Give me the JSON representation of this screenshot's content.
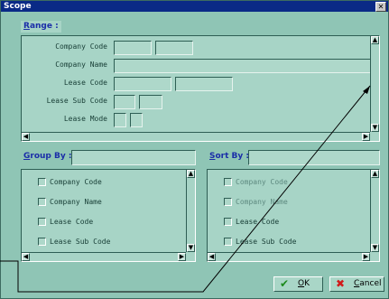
{
  "window": {
    "title": "Scope",
    "close_glyph": "✕"
  },
  "range": {
    "label": "Range :",
    "label_hotkey": "R",
    "label_rest": "ange :",
    "rows": [
      {
        "label": "Company Code"
      },
      {
        "label": "Company Name"
      },
      {
        "label": "Lease Code"
      },
      {
        "label": "Lease Sub Code"
      },
      {
        "label": "Lease Mode"
      }
    ]
  },
  "group_by": {
    "label_hotkey": "G",
    "label_rest": "roup By :",
    "options": [
      {
        "label": "Company Code"
      },
      {
        "label": "Company Name"
      },
      {
        "label": "Lease Code"
      },
      {
        "label": "Lease Sub Code"
      }
    ]
  },
  "sort_by": {
    "label_hotkey": "S",
    "label_rest": "ort By :",
    "options": [
      {
        "label": "Company Code",
        "disabled": true
      },
      {
        "label": "Company Name",
        "disabled": true
      },
      {
        "label": "Lease Code",
        "disabled": false
      },
      {
        "label": "Lease Sub Code",
        "disabled": false
      }
    ]
  },
  "buttons": {
    "ok_hotkey": "O",
    "ok_rest": "K",
    "cancel_hotkey": "C",
    "cancel_rest": "ancel",
    "ok_icon": "✔",
    "cancel_icon": "✖"
  },
  "colors": {
    "title_bar": "#0a2a86",
    "accent_label": "#1b2ea8",
    "panel": "#8fc5b5",
    "ok_green": "#1d8a1d",
    "cancel_red": "#d11b1b"
  }
}
